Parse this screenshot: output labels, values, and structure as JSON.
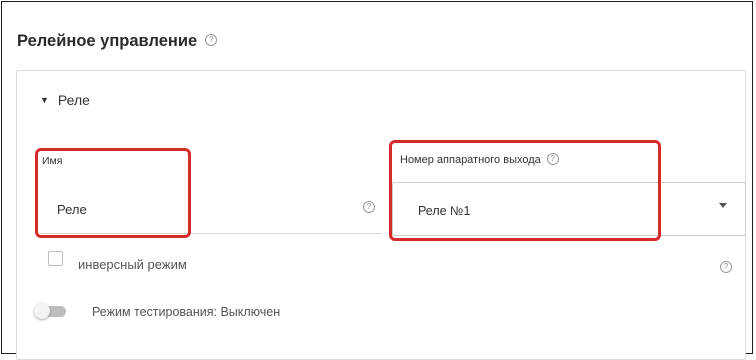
{
  "page": {
    "title": "Релейное управление",
    "title_help_icon": "help-circle-icon"
  },
  "section": {
    "label": "Реле",
    "caret_icon": "caret-down-icon",
    "caret_glyph": "▼"
  },
  "name_field": {
    "label": "Имя",
    "value": "Реле",
    "help_icon": "help-circle-icon"
  },
  "output_field": {
    "label": "Номер аппаратного выхода",
    "help_icon": "help-circle-icon",
    "value": "Реле №1",
    "arrow_icon": "chevron-down-icon"
  },
  "inverse_mode": {
    "label": "инверсный режим",
    "checked": false,
    "help_icon": "help-circle-icon"
  },
  "test_mode": {
    "label": "Режим тестирования: Выключен",
    "on": false
  },
  "icon_glyphs": {
    "help": "?"
  },
  "colors": {
    "highlight": "#d62b2b",
    "border": "#1e1e1e"
  }
}
